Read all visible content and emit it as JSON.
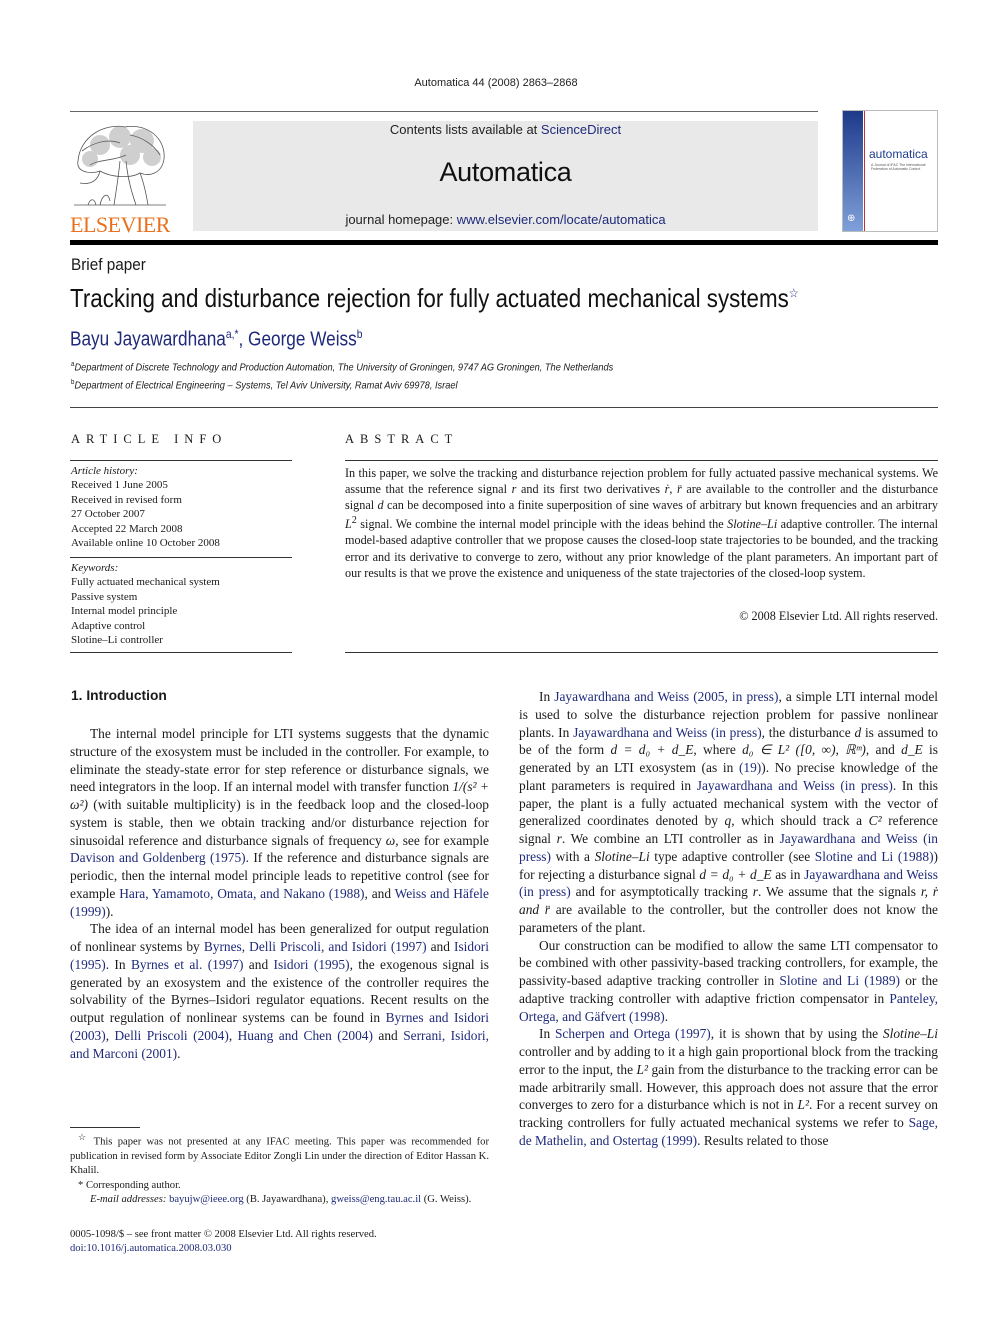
{
  "header": {
    "citation": "Automatica 44 (2008) 2863–2868",
    "contents_prefix": "Contents lists available at ",
    "contents_link": "ScienceDirect",
    "journal_title": "Automatica",
    "homepage_prefix": "journal homepage: ",
    "homepage_link": "www.elsevier.com/locate/automatica",
    "publisher_logo": "ELSEVIER",
    "cover_title": "automatica",
    "cover_subtitle": "A Journal of IFAC The International Federation of Automatic Control"
  },
  "article": {
    "type": "Brief paper",
    "title": "Tracking and disturbance rejection for fully actuated mechanical systems",
    "title_mark": "☆",
    "authors": [
      {
        "name": "Bayu Jayawardhana",
        "sup": "a,*"
      },
      {
        "name": "George Weiss",
        "sup": "b"
      }
    ],
    "author_sep": ", ",
    "affiliations": [
      {
        "sup": "a",
        "text": "Department of Discrete Technology and Production Automation, The University of Groningen, 9747 AG Groningen, The Netherlands"
      },
      {
        "sup": "b",
        "text": "Department of Electrical Engineering – Systems, Tel Aviv University, Ramat Aviv 69978, Israel"
      }
    ]
  },
  "article_info": {
    "heading": "ARTICLE INFO",
    "history_label": "Article history:",
    "history": [
      "Received 1 June 2005",
      "Received in revised form",
      "27 October 2007",
      "Accepted 22 March 2008",
      "Available online 10 October 2008"
    ],
    "keywords_label": "Keywords:",
    "keywords": [
      "Fully actuated mechanical system",
      "Passive system",
      "Internal model principle",
      "Adaptive control",
      "Slotine–Li controller"
    ]
  },
  "abstract": {
    "heading": "ABSTRACT",
    "s1": "In this paper, we solve the tracking and disturbance rejection problem for fully actuated passive mechanical systems. We assume that the reference signal ",
    "v_r": "r",
    "s2": " and its first two derivatives ",
    "v_rdot": "ṙ",
    "s3": ", ",
    "v_rddot": "r̈",
    "s4": " are available to the controller and the disturbance signal ",
    "v_d": "d",
    "s5": " can be decomposed into a finite superposition of sine waves of arbitrary but known frequencies and an arbitrary ",
    "v_L": "L",
    "v_L_sup": "2",
    "s6": " signal. We combine the internal model principle with the ideas behind the ",
    "v_sl": "Slotine–Li",
    "s7": " adaptive controller. The internal model-based adaptive controller that we propose causes the closed-loop state trajectories to be bounded, and the tracking error and its derivative to converge to zero, without any prior knowledge of the plant parameters. An important part of our results is that we prove the existence and uniqueness of the state trajectories of the closed-loop system.",
    "copyright": "© 2008 Elsevier Ltd. All rights reserved."
  },
  "intro": {
    "heading": "1.  Introduction",
    "p1": {
      "a": "The internal model principle for LTI systems suggests that the dynamic structure of the exosystem must be included in the controller. For example, to eliminate the steady-state error for step reference or disturbance signals, we need integrators in the loop. If an internal model with transfer function ",
      "tf": "1/(s² + ω²)",
      "b": " (with suitable multiplicity) is in the feedback loop and the closed-loop system is stable, then we obtain tracking and/or disturbance rejection for sinusoidal reference and disturbance signals of frequency ",
      "omega": "ω",
      "c": ", see for example ",
      "ref1": "Davison and Goldenberg",
      "ref1y": " (1975)",
      "d": ". If the reference and disturbance signals are periodic, then the internal model principle leads to repetitive control (see for example ",
      "ref2": "Hara, Yamamoto, Omata, and Nakano",
      "ref2y": " (1988)",
      "e": ", and ",
      "ref3": "Weiss and Häfele",
      "ref3y": " (1999)",
      "f": ")."
    },
    "p2": {
      "a": "The idea of an internal model has been generalized for output regulation of nonlinear systems by ",
      "ref1": "Byrnes, Delli Priscoli, and Isidori",
      "ref1y": " (1997)",
      "b": " and ",
      "ref2": "Isidori",
      "ref2y": " (1995)",
      "c": ". In ",
      "ref3": "Byrnes et al.",
      "ref3y": " (1997)",
      "d": " and ",
      "ref4": "Isidori",
      "ref4y": " (1995)",
      "e": ", the exogenous signal is generated by an exosystem and the existence of the controller requires the solvability of the Byrnes–Isidori regulator equations. Recent results on the output regulation of nonlinear systems can be found in ",
      "ref5": "Byrnes and Isidori",
      "ref5y": " (2003)",
      "f": ", ",
      "ref6": "Delli Priscoli",
      "ref6y": " (2004)",
      "g": ", ",
      "ref7": "Huang and Chen",
      "ref7y": " (2004)",
      "h": " and ",
      "ref8": "Serrani, Isidori, and Marconi",
      "ref8y": " (2001)",
      "i": "."
    },
    "p3": {
      "a": "In ",
      "ref1": "Jayawardhana and Weiss (2005, in press)",
      "b": ", a simple LTI internal model is used to solve the disturbance rejection problem for passive nonlinear plants. In ",
      "ref2": "Jayawardhana and Weiss (in press)",
      "c": ", the disturbance ",
      "d_var": "d",
      "d": " is assumed to be of the form ",
      "eq1": "d = d₀ + d_E",
      "e": ", where ",
      "eq2": "d₀ ∈ L² ([0, ∞), ℝᵐ)",
      "f": ", and ",
      "dE": "d_E",
      "g": " is generated by an LTI exosystem (as in ",
      "eqref": "(19)",
      "h": "). No precise knowledge of the plant parameters is required in ",
      "ref3": "Jayawardhana and Weiss (in press)",
      "i": ". In this paper, the plant is a fully actuated mechanical system with the vector of generalized coordinates denoted by ",
      "q": "q",
      "j": ", which should track a ",
      "c2": "C²",
      "k": " reference signal ",
      "r1": "r",
      "l": ". We combine an LTI controller as in ",
      "ref4": "Jayawardhana and Weiss (in press)",
      "m": " with a ",
      "sl": "Slotine–Li",
      "n": " type adaptive controller (see ",
      "ref5": "Slotine and Li (1988)",
      "o": ") for rejecting a disturbance signal ",
      "eq3": "d = d₀ + d_E",
      "p": " as in ",
      "ref6": "Jayawardhana and Weiss (in press)",
      "q2": " and for asymptotically tracking ",
      "r2": "r",
      "s": ". We assume that the signals ",
      "sig": "r, ṙ and r̈",
      "t": " are available to the controller, but the controller does not know the parameters of the plant."
    },
    "p4": {
      "a": "Our construction can be modified to allow the same LTI compensator to be combined with other passivity-based tracking controllers, for example, the passivity-based adaptive tracking controller in ",
      "ref1": "Slotine and Li",
      "ref1y": " (1989)",
      "b": " or the adaptive tracking controller with adaptive friction compensator in ",
      "ref2": "Panteley, Ortega, and Gäfvert",
      "ref2y": " (1998)",
      "c": "."
    },
    "p5": {
      "a": "In ",
      "ref1": "Scherpen and Ortega",
      "ref1y": " (1997)",
      "b": ", it is shown that by using the ",
      "sl": "Slotine–Li",
      "c": " controller and by adding to it a high gain proportional block from the tracking error to the input, the ",
      "L2a": "L²",
      "d": " gain from the disturbance to the tracking error can be made arbitrarily small. However, this approach does not assure that the error converges to zero for a disturbance which is not in ",
      "L2b": "L²",
      "e": ". For a recent survey on tracking controllers for fully actuated mechanical systems we refer to ",
      "ref2": "Sage, de Mathelin, and Ostertag",
      "ref2y": " (1999)",
      "f": ". Results related to those"
    }
  },
  "footnotes": {
    "star_mark": "☆",
    "star_text": " This paper was not presented at any IFAC meeting. This paper was recommended for publication in revised form by Associate Editor Zongli Lin under the direction of Editor Hassan K. Khalil.",
    "corr_mark": "*",
    "corr_text": " Corresponding author.",
    "email_label": "E-mail addresses: ",
    "email1": "bayujw@ieee.org",
    "email1_name": " (B. Jayawardhana), ",
    "email2": "gweiss@eng.tau.ac.il",
    "email2_name": " (G. Weiss)."
  },
  "front_matter": {
    "issn_line": "0005-1098/$ – see front matter © 2008 Elsevier Ltd. All rights reserved.",
    "doi": "doi:10.1016/j.automatica.2008.03.030"
  },
  "colors": {
    "link": "#1f2a7a",
    "elsevier_orange": "#e8711f",
    "banner_bg": "#e9e9e9"
  }
}
